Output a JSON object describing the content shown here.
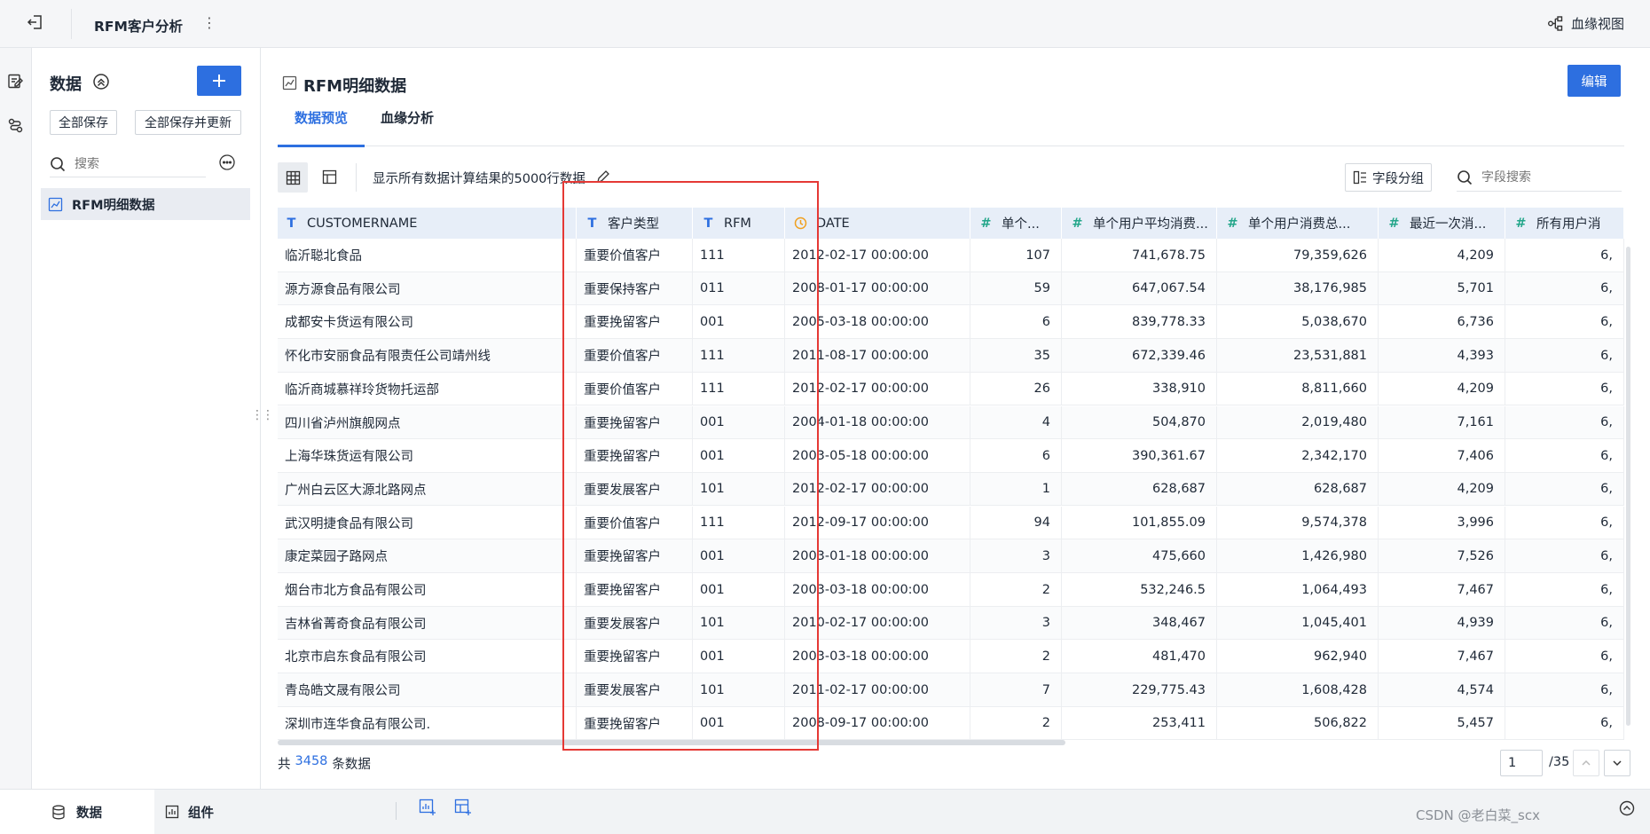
{
  "app": {
    "title": "RFM客户分析",
    "lineage_view": "血缘视图"
  },
  "sidebar": {
    "title": "数据",
    "save_all": "全部保存",
    "save_update_all": "全部保存并更新",
    "search_placeholder": "搜索",
    "items": [
      {
        "label": "RFM明细数据"
      }
    ]
  },
  "main": {
    "title": "RFM明细数据",
    "edit": "编辑",
    "tabs": [
      {
        "label": "数据预览"
      },
      {
        "label": "血缘分析"
      }
    ],
    "info": "显示所有数据计算结果的5000行数据",
    "field_group": "字段分组",
    "field_search_placeholder": "字段搜索"
  },
  "table": {
    "columns": [
      {
        "label": "CUSTOMERNAME",
        "icon": "T",
        "type": "text"
      },
      {
        "label": "客户类型",
        "icon": "T",
        "type": "text"
      },
      {
        "label": "RFM",
        "icon": "T",
        "type": "text"
      },
      {
        "label": "DATE",
        "icon": "clock",
        "type": "date"
      },
      {
        "label": "单个...",
        "icon": "#",
        "type": "number"
      },
      {
        "label": "单个用户平均消费...",
        "icon": "#",
        "type": "number"
      },
      {
        "label": "单个用户消费总...",
        "icon": "#",
        "type": "number"
      },
      {
        "label": "最近一次消...",
        "icon": "#",
        "type": "number"
      },
      {
        "label": "所有用户消",
        "icon": "#",
        "type": "number"
      }
    ],
    "rows": [
      [
        "临沂聪北食品",
        "重要价值客户",
        "111",
        "2012-02-17 00:00:00",
        "107",
        "741,678.75",
        "79,359,626",
        "4,209",
        "6,"
      ],
      [
        "源方源食品有限公司",
        "重要保持客户",
        "011",
        "2008-01-17 00:00:00",
        "59",
        "647,067.54",
        "38,176,985",
        "5,701",
        "6,"
      ],
      [
        "成都安卡货运有限公司",
        "重要挽留客户",
        "001",
        "2005-03-18 00:00:00",
        "6",
        "839,778.33",
        "5,038,670",
        "6,736",
        "6,"
      ],
      [
        "怀化市安丽食品有限责任公司靖州线",
        "重要价值客户",
        "111",
        "2011-08-17 00:00:00",
        "35",
        "672,339.46",
        "23,531,881",
        "4,393",
        "6,"
      ],
      [
        "临沂商城慕祥玲货物托运部",
        "重要价值客户",
        "111",
        "2012-02-17 00:00:00",
        "26",
        "338,910",
        "8,811,660",
        "4,209",
        "6,"
      ],
      [
        "四川省泸州旗舰网点",
        "重要挽留客户",
        "001",
        "2004-01-18 00:00:00",
        "4",
        "504,870",
        "2,019,480",
        "7,161",
        "6,"
      ],
      [
        "上海华珠货运有限公司",
        "重要挽留客户",
        "001",
        "2003-05-18 00:00:00",
        "6",
        "390,361.67",
        "2,342,170",
        "7,406",
        "6,"
      ],
      [
        "广州白云区大源北路网点",
        "重要发展客户",
        "101",
        "2012-02-17 00:00:00",
        "1",
        "628,687",
        "628,687",
        "4,209",
        "6,"
      ],
      [
        "武汉明捷食品有限公司",
        "重要价值客户",
        "111",
        "2012-09-17 00:00:00",
        "94",
        "101,855.09",
        "9,574,378",
        "3,996",
        "6,"
      ],
      [
        "康定菜园子路网点",
        "重要挽留客户",
        "001",
        "2003-01-18 00:00:00",
        "3",
        "475,660",
        "1,426,980",
        "7,526",
        "6,"
      ],
      [
        "烟台市北方食品有限公司",
        "重要挽留客户",
        "001",
        "2003-03-18 00:00:00",
        "2",
        "532,246.5",
        "1,064,493",
        "7,467",
        "6,"
      ],
      [
        "吉林省菁奇食品有限公司",
        "重要发展客户",
        "101",
        "2010-02-17 00:00:00",
        "3",
        "348,467",
        "1,045,401",
        "4,939",
        "6,"
      ],
      [
        "北京市启东食品有限公司",
        "重要挽留客户",
        "001",
        "2003-03-18 00:00:00",
        "2",
        "481,470",
        "962,940",
        "7,467",
        "6,"
      ],
      [
        "青岛皓文晟有限公司",
        "重要发展客户",
        "101",
        "2011-02-17 00:00:00",
        "7",
        "229,775.43",
        "1,608,428",
        "4,574",
        "6,"
      ],
      [
        "深圳市连华食品有限公司.",
        "重要挽留客户",
        "001",
        "2008-09-17 00:00:00",
        "2",
        "253,411",
        "506,822",
        "5,457",
        "6,"
      ]
    ]
  },
  "footer": {
    "prefix": "共",
    "count": "3458",
    "suffix": "条数据",
    "page": "1",
    "total_pages": "/35"
  },
  "bottom": {
    "tab_data": "数据",
    "tab_component": "组件"
  },
  "watermark": "CSDN @老白菜_scx",
  "colors": {
    "accent": "#2d6fe0",
    "header_bg": "#e7eef8",
    "highlight": "#e53935",
    "date_icon": "#f0a020",
    "number_icon": "#23a68a"
  }
}
